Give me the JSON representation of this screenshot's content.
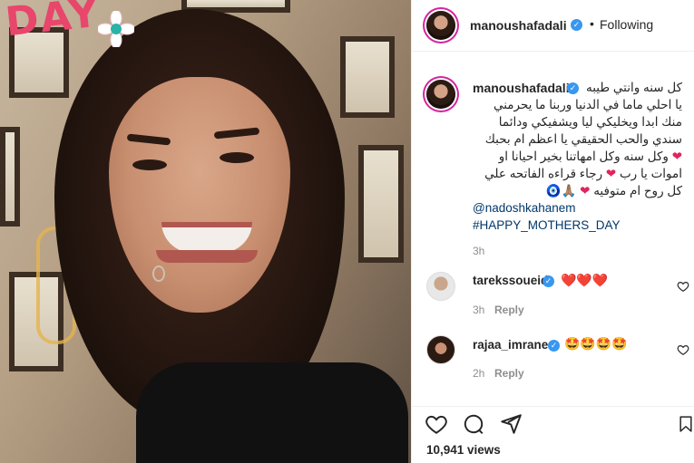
{
  "post": {
    "author": "manoushafadali",
    "dot": "•",
    "following_label": "Following"
  },
  "caption": {
    "author": "manoushafadali",
    "lines": [
      "كل سنه وانتي طيبه",
      "يا احلي ماما في الدنيا وربنا ما يحرمني",
      "منك ابدا ويخليكي ليا ويشفيكي ودائما",
      "سندي والحب الحقيقي يا اعظم ام بحبك",
      "وكل سنه وكل امهاتنا بخير احيانا او",
      "اموات يا رب",
      "رجاء قراءه الفاتحه علي",
      "كل روح ام متوفيه"
    ],
    "mention": "@nadoshkahanem",
    "hashtag": "#HAPPY_MOTHERS_DAY",
    "time": "3h"
  },
  "comments": [
    {
      "user": "tarekssoueid",
      "text": "❤️❤️❤️",
      "time": "3h",
      "reply": "Reply"
    },
    {
      "user": "rajaa_imrane",
      "text": "🤩🤩🤩🤩",
      "time": "2h",
      "reply": "Reply"
    }
  ],
  "stats": {
    "views": "10,941 views"
  },
  "media": {
    "sticker_text": "DAY"
  },
  "icons": {
    "verified": "verified-badge-icon",
    "like": "heart-outline-icon",
    "comment": "comment-bubble-icon",
    "share": "paper-plane-icon",
    "save": "bookmark-icon"
  },
  "colors": {
    "verified": "#3897f0",
    "heart": "#e0245e",
    "link": "#00376b",
    "muted": "#8e8e8e"
  }
}
